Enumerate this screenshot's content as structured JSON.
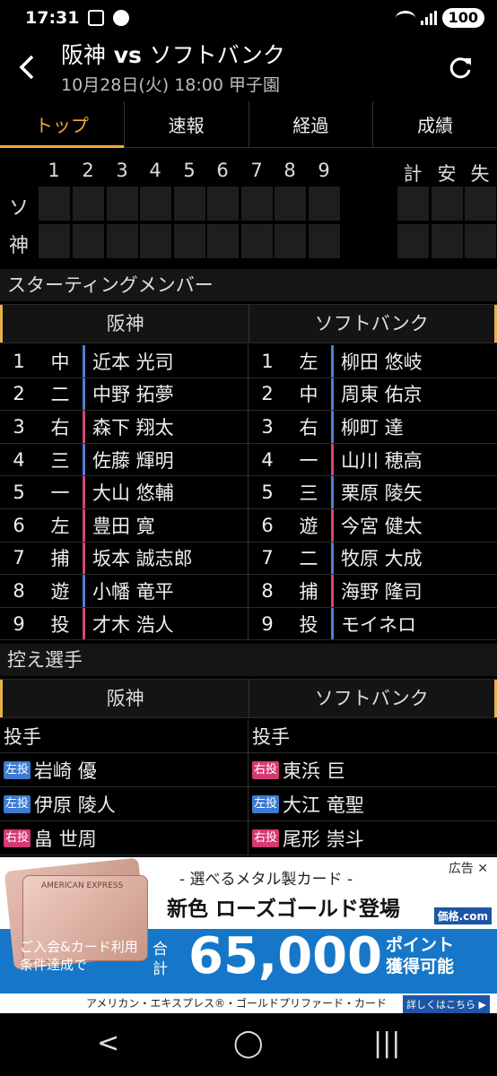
{
  "status": {
    "time": "17:31",
    "battery": "100"
  },
  "header": {
    "home": "阪神",
    "vs": " vs ",
    "away": "ソフトバンク",
    "info": "10月28日(火) 18:00 甲子園"
  },
  "tabs": [
    "トップ",
    "速報",
    "経過",
    "成績"
  ],
  "scoreboard": {
    "innings": [
      "1",
      "2",
      "3",
      "4",
      "5",
      "6",
      "7",
      "8",
      "9"
    ],
    "totals": [
      "計",
      "安",
      "失"
    ],
    "teams": [
      "ソ",
      "神"
    ]
  },
  "starting": {
    "title": "スターティングメンバー",
    "home_team": "阪神",
    "away_team": "ソフトバンク",
    "home": [
      {
        "order": "1",
        "pos": "中",
        "name": "近本 光司",
        "hand": "b"
      },
      {
        "order": "2",
        "pos": "二",
        "name": "中野 拓夢",
        "hand": "b"
      },
      {
        "order": "3",
        "pos": "右",
        "name": "森下 翔太",
        "hand": "r"
      },
      {
        "order": "4",
        "pos": "三",
        "name": "佐藤 輝明",
        "hand": "b"
      },
      {
        "order": "5",
        "pos": "一",
        "name": "大山 悠輔",
        "hand": "r"
      },
      {
        "order": "6",
        "pos": "左",
        "name": "豊田 寛",
        "hand": "r"
      },
      {
        "order": "7",
        "pos": "捕",
        "name": "坂本 誠志郎",
        "hand": "r"
      },
      {
        "order": "8",
        "pos": "遊",
        "name": "小幡 竜平",
        "hand": "b"
      },
      {
        "order": "9",
        "pos": "投",
        "name": "才木 浩人",
        "hand": "r"
      }
    ],
    "away": [
      {
        "order": "1",
        "pos": "左",
        "name": "柳田 悠岐",
        "hand": "b"
      },
      {
        "order": "2",
        "pos": "中",
        "name": "周東 佑京",
        "hand": "b"
      },
      {
        "order": "3",
        "pos": "右",
        "name": "柳町 達",
        "hand": "b"
      },
      {
        "order": "4",
        "pos": "一",
        "name": "山川 穂高",
        "hand": "r"
      },
      {
        "order": "5",
        "pos": "三",
        "name": "栗原 陵矢",
        "hand": "b"
      },
      {
        "order": "6",
        "pos": "遊",
        "name": "今宮 健太",
        "hand": "r"
      },
      {
        "order": "7",
        "pos": "二",
        "name": "牧原 大成",
        "hand": "b"
      },
      {
        "order": "8",
        "pos": "捕",
        "name": "海野 隆司",
        "hand": "r"
      },
      {
        "order": "9",
        "pos": "投",
        "name": "モイネロ",
        "hand": "b"
      }
    ]
  },
  "reserves": {
    "title": "控え選手",
    "home_team": "阪神",
    "away_team": "ソフトバンク",
    "pitcher_label": "投手",
    "home": [
      {
        "tag": "左投",
        "name": "岩崎 優",
        "side": "l"
      },
      {
        "tag": "左投",
        "name": "伊原 陵人",
        "side": "l"
      },
      {
        "tag": "右投",
        "name": "畠 世周",
        "side": "r"
      }
    ],
    "away": [
      {
        "tag": "右投",
        "name": "東浜 巨",
        "side": "r"
      },
      {
        "tag": "左投",
        "name": "大江 竜聖",
        "side": "l"
      },
      {
        "tag": "右投",
        "name": "尾形 崇斗",
        "side": "r"
      }
    ]
  },
  "ad": {
    "label": "広告",
    "line1": "- 選べるメタル製カード -",
    "line2": "新色 ローズゴールド登場",
    "site": "価格.com",
    "cond1": "ご入会&カード利用",
    "cond2": "条件達成で",
    "total": "合計",
    "amount": "65,000",
    "points1": "ポイント",
    "points2": "獲得可能",
    "footer": "アメリカン・エキスプレス®・ゴールドプリファード・カード",
    "details": "詳しくはこちら ▶",
    "card_brand": "AMERICAN EXPRESS"
  }
}
